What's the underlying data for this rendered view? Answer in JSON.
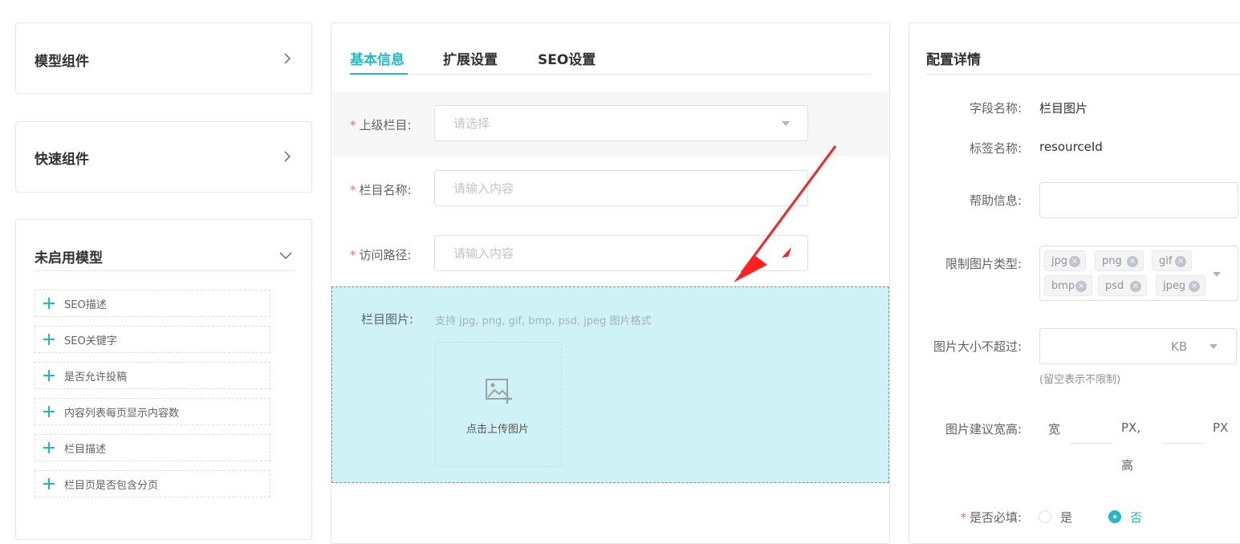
{
  "left": {
    "model_components": "模型组件",
    "quick_components": "快速组件",
    "disabled_models": "未启用模型",
    "items": [
      "SEO描述",
      "SEO关键字",
      "是否允许投稿",
      "内容列表每页显示内容数",
      "栏目描述",
      "栏目页是否包含分页"
    ]
  },
  "middle": {
    "tabs": [
      "基本信息",
      "扩展设置",
      "SEO设置"
    ],
    "fields": {
      "parent": {
        "label": "上级栏目:",
        "placeholder": "请选择"
      },
      "name": {
        "label": "栏目名称:",
        "placeholder": "请输入内容"
      },
      "path": {
        "label": "访问路径:",
        "placeholder": "请输入内容"
      },
      "image": {
        "label": "栏目图片:",
        "hint": "支持 jpg, png, gif, bmp, psd, jpeg 图片格式",
        "upload_text": "点击上传图片"
      }
    },
    "required_mark": "*"
  },
  "right": {
    "title": "配置详情",
    "field_name_label": "字段名称:",
    "field_name_value": "栏目图片",
    "tag_name_label": "标签名称:",
    "tag_name_value": "resourceId",
    "help_label": "帮助信息:",
    "help_value": "",
    "limit_types_label": "限制图片类型:",
    "limit_types": [
      "jpg",
      "png",
      "gif",
      "bmp",
      "psd",
      "jpeg"
    ],
    "max_size_label": "图片大小不超过:",
    "max_size_unit": "KB",
    "max_size_hint": "(留空表示不限制)",
    "suggest_label": "图片建议宽高:",
    "width_label": "宽",
    "px_comma": "PX,",
    "px": "PX",
    "height_label": "高",
    "required_label": "是否必填:",
    "required_star": "*",
    "yes": "是",
    "no": "否",
    "required_selected": "否"
  },
  "colors": {
    "accent": "#21b8c9",
    "required": "#f56c6c",
    "highlight_bg": "#cff2f7",
    "arrow": "#ff2020"
  }
}
